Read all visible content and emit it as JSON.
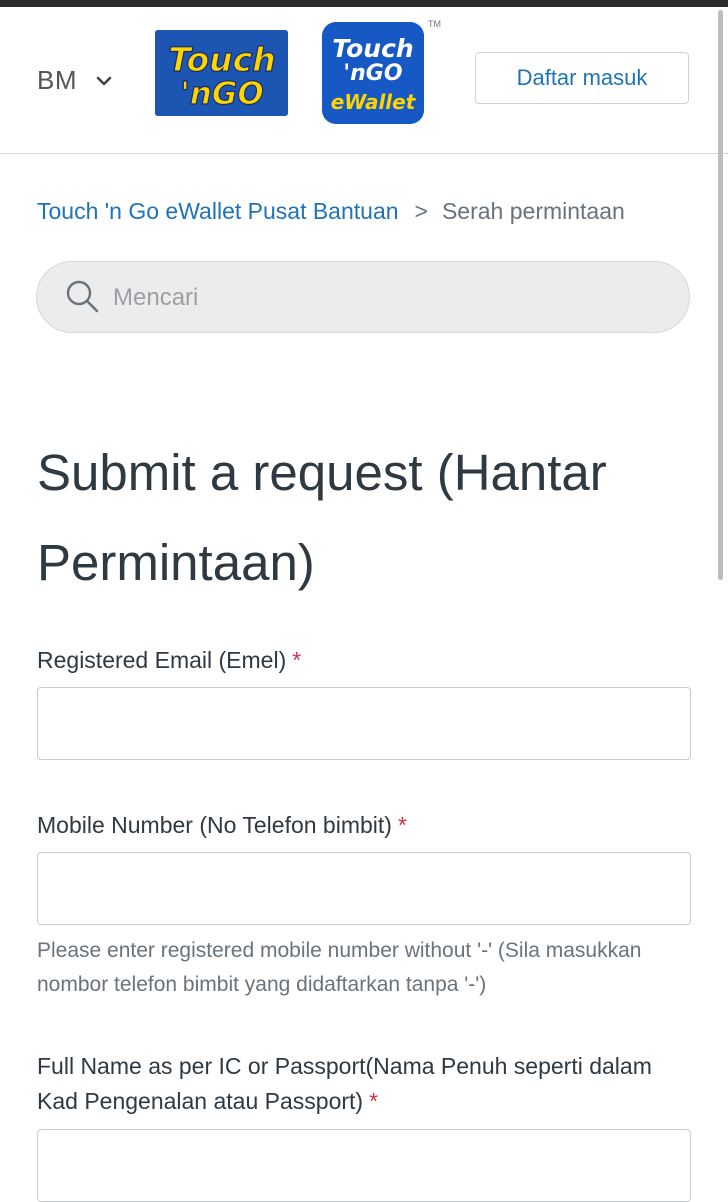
{
  "header": {
    "language": "BM",
    "logo_touchngo": {
      "line1": "Touch",
      "line2": "'nGO"
    },
    "logo_ewallet": {
      "line1": "Touch",
      "line2": "'nGO",
      "line3": "eWallet",
      "tm": "TM"
    },
    "sign_in_label": "Daftar masuk"
  },
  "breadcrumb": {
    "home": "Touch 'n Go eWallet Pusat Bantuan",
    "separator": ">",
    "current": "Serah permintaan"
  },
  "search": {
    "placeholder": "Mencari"
  },
  "page_title": "Submit a request (Hantar Permintaan)",
  "form": {
    "required_mark": "*",
    "email": {
      "label": "Registered Email (Emel)",
      "value": ""
    },
    "mobile": {
      "label": "Mobile Number (No Telefon bimbit)",
      "value": "",
      "hint": "Please enter registered mobile number without '-' (Sila masukkan nombor telefon bimbit yang didaftarkan tanpa '-')"
    },
    "full_name": {
      "label": "Full Name as per IC or Passport(Nama Penuh seperti dalam Kad Pengenalan atau Passport)",
      "value": ""
    }
  },
  "colors": {
    "link": "#1f73b7",
    "brand_blue": "#1d55b3",
    "brand_yellow": "#ffd400",
    "required": "#cc3340"
  }
}
